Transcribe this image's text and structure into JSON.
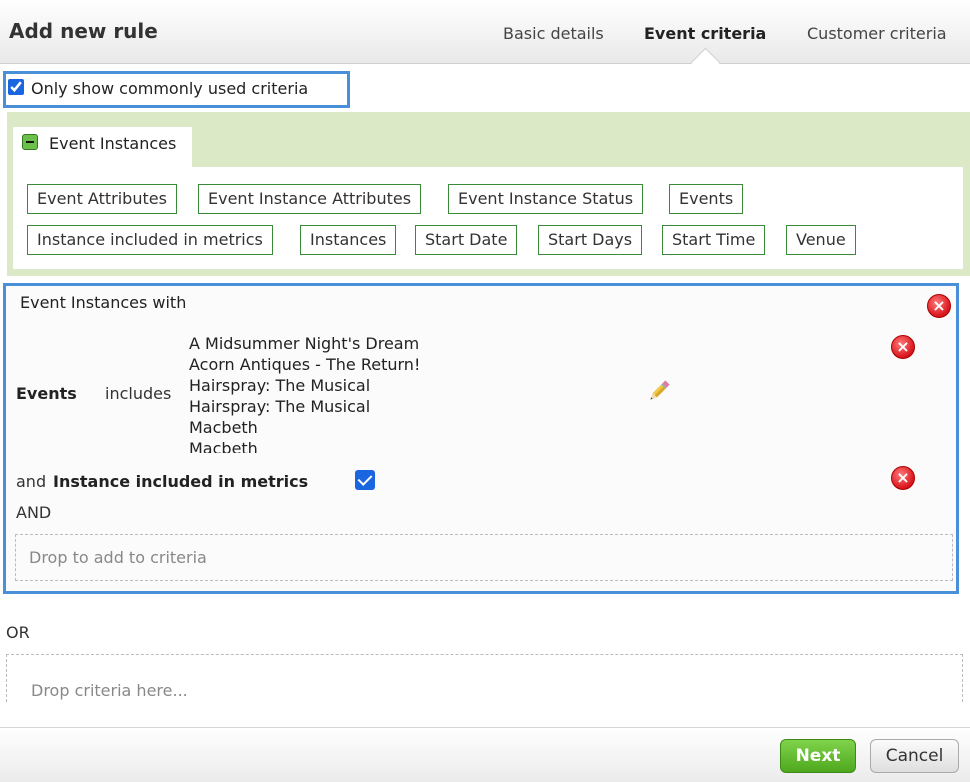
{
  "header": {
    "title": "Add new rule",
    "tabs": [
      "Basic details",
      "Event criteria",
      "Customer criteria"
    ],
    "active_tab": "Event criteria"
  },
  "filter": {
    "common_label": "Only show commonly used criteria",
    "checked": true
  },
  "criteria_group": {
    "label": "Event Instances",
    "chips": [
      "Event Attributes",
      "Event Instance Attributes",
      "Event Instance Status",
      "Events",
      "Instance included in metrics",
      "Instances",
      "Start Date",
      "Start Days",
      "Start Time",
      "Venue"
    ]
  },
  "rule": {
    "title": "Event Instances with",
    "events_label": "Events",
    "events_op": "includes",
    "event_values": [
      "A Midsummer Night's Dream",
      "Acorn Antiques - The Return!",
      "Hairspray: The Musical",
      "Hairspray: The Musical",
      "Macbeth",
      "Macbeth"
    ],
    "metrics_prefix": "and",
    "metrics_label": "Instance included in metrics",
    "metrics_checked": true,
    "and_label": "AND",
    "drop_add": "Drop to add to criteria"
  },
  "or_label": "OR",
  "drop_here": "Drop criteria here...",
  "footer": {
    "next": "Next",
    "cancel": "Cancel"
  },
  "colors": {
    "accent_blue": "#4a90d9",
    "panel_green": "#dbe9c7",
    "next_green": "#5cb82a",
    "delete_red": "#d8141c"
  },
  "icons": [
    "checkbox-icon",
    "collapse-minus-icon",
    "delete-icon",
    "edit-pencil-icon"
  ]
}
